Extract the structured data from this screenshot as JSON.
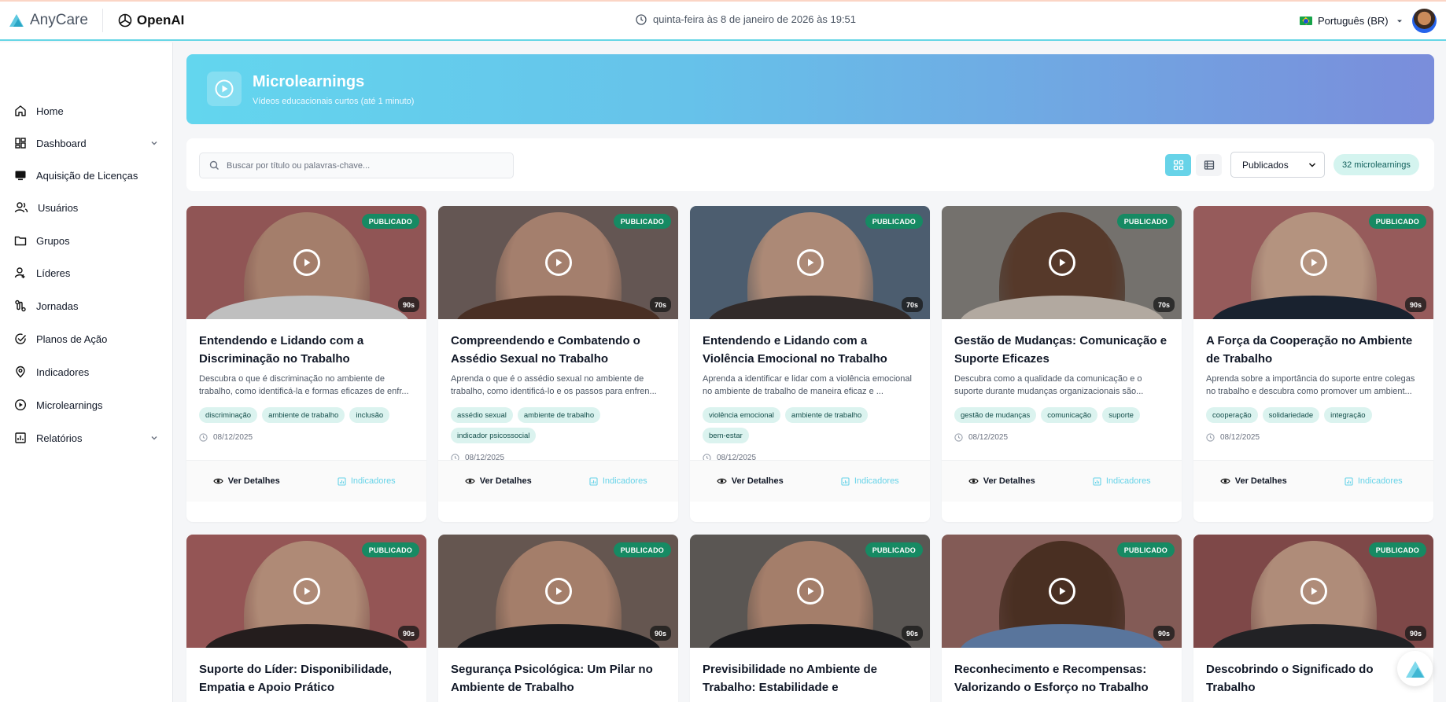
{
  "header": {
    "brand_name": "AnyCare",
    "partner_name": "OpenAI",
    "datetime": "quinta-feira às 8 de janeiro de 2026 às 19:51",
    "language": "Português (BR)"
  },
  "sidebar": {
    "items": [
      {
        "label": "Home",
        "icon": "home-icon"
      },
      {
        "label": "Dashboard",
        "icon": "dashboard-icon",
        "expandable": true
      },
      {
        "label": "Aquisição de Licenças",
        "icon": "monitor-icon"
      },
      {
        "label": "Usuários",
        "icon": "users-icon"
      },
      {
        "label": "Grupos",
        "icon": "folder-icon"
      },
      {
        "label": "Líderes",
        "icon": "leader-icon"
      },
      {
        "label": "Jornadas",
        "icon": "route-icon"
      },
      {
        "label": "Planos de Ação",
        "icon": "check-circle-icon"
      },
      {
        "label": "Indicadores",
        "icon": "pin-icon"
      },
      {
        "label": "Microlearnings",
        "icon": "play-circle-icon"
      },
      {
        "label": "Relatórios",
        "icon": "report-icon",
        "expandable": true
      }
    ]
  },
  "banner": {
    "title": "Microlearnings",
    "subtitle": "Vídeos educacionais curtos (até 1 minuto)"
  },
  "toolbar": {
    "search_placeholder": "Buscar por título ou palavras-chave...",
    "filter_selected": "Publicados",
    "count_label": "32 microlearnings"
  },
  "labels": {
    "published": "PUBLICADO",
    "details": "Ver Detalhes",
    "indicators": "Indicadores"
  },
  "cards": [
    {
      "title": "Entendendo e Lidando com a Discriminação no Trabalho",
      "description": "Descubra o que é discriminação no ambiente de trabalho, como identificá-la e formas eficazes de enfr...",
      "duration": "90s",
      "tags": [
        "discriminação",
        "ambiente de trabalho",
        "inclusão"
      ],
      "date": "08/12/2025",
      "bg": "#b06868",
      "skin": "#c99a83",
      "clothes": "#e9e9ea"
    },
    {
      "title": "Compreendendo e Combatendo o Assédio Sexual no Trabalho",
      "description": "Aprenda o que é o assédio sexual no ambiente de trabalho, como identificá-lo e os passos para enfren...",
      "duration": "70s",
      "tags": [
        "assédio sexual",
        "ambiente de trabalho",
        "indicador psicossocial"
      ],
      "date": "08/12/2025",
      "bg": "#7a6a66",
      "skin": "#c99b85",
      "clothes": "#5a3a2c"
    },
    {
      "title": "Entendendo e Lidando com a Violência Emocional no Trabalho",
      "description": "Aprenda a identificar e lidar com a violência emocional no ambiente de trabalho de maneira eficaz e ...",
      "duration": "70s",
      "tags": [
        "violência emocional",
        "ambiente de trabalho",
        "bem-estar"
      ],
      "date": "08/12/2025",
      "bg": "#5d7288",
      "skin": "#d2a890",
      "clothes": "#3d3534"
    },
    {
      "title": "Gestão de Mudanças: Comunicação e Suporte Eficazes",
      "description": "Descubra como a qualidade da comunicação e o suporte durante mudanças organizacionais são...",
      "duration": "70s",
      "tags": [
        "gestão de mudanças",
        "comunicação",
        "suporte"
      ],
      "date": "08/12/2025",
      "bg": "#8e8a86",
      "skin": "#6a4634",
      "clothes": "#d9cfc4"
    },
    {
      "title": "A Força da Cooperação no Ambiente de Trabalho",
      "description": "Aprenda sobre a importância do suporte entre colegas no trabalho e descubra como promover um ambient...",
      "duration": "90s",
      "tags": [
        "cooperação",
        "solidariedade",
        "integração"
      ],
      "date": "08/12/2025",
      "bg": "#b76f6f",
      "skin": "#dcb49c",
      "clothes": "#1f2a3a"
    },
    {
      "title": "Suporte do Líder: Disponibilidade, Empatia e Apoio Prático",
      "duration": "90s",
      "bg": "#b56868",
      "skin": "#d6a990",
      "clothes": "#2c2424"
    },
    {
      "title": "Segurança Psicológica: Um Pilar no Ambiente de Trabalho",
      "duration": "90s",
      "bg": "#7c6a62",
      "skin": "#c99a82",
      "clothes": "#1e1e22"
    },
    {
      "title": "Previsibilidade no Ambiente de Trabalho: Estabilidade e Comunicação",
      "duration": "90s",
      "bg": "#6e6a66",
      "skin": "#c99a82",
      "clothes": "#1e1e22"
    },
    {
      "title": "Reconhecimento e Recompensas: Valorizando o Esforço no Trabalho",
      "duration": "90s",
      "bg": "#a0706a",
      "skin": "#5a3a2a",
      "clothes": "#6d8fbf"
    },
    {
      "title": "Descobrindo o Significado do Trabalho",
      "duration": "90s",
      "bg": "#9a5858",
      "skin": "#d6ab94",
      "clothes": "#2a2a2e"
    }
  ]
}
